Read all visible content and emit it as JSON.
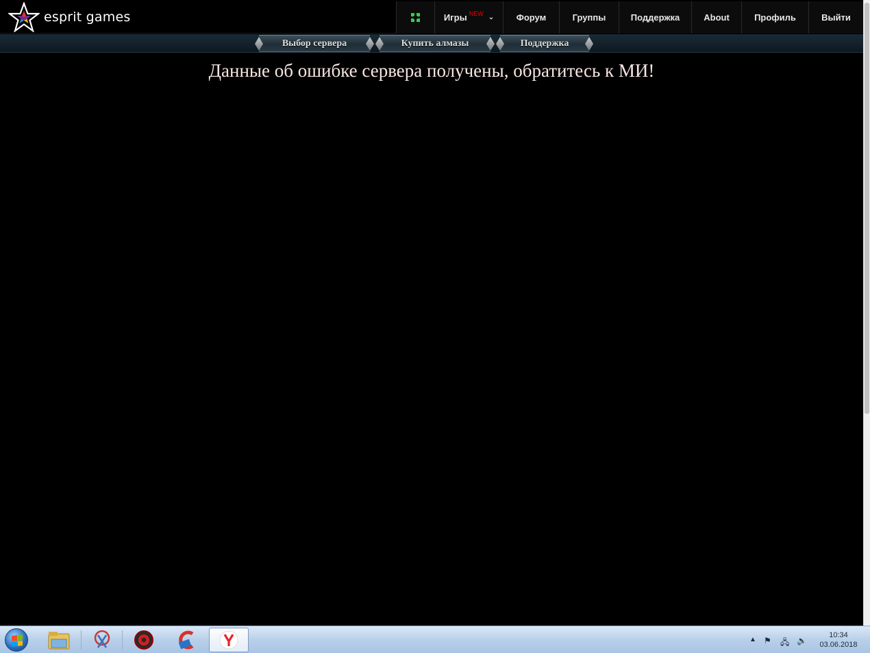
{
  "logo": {
    "text": "esprit games"
  },
  "topnav": {
    "fullscreen_icon": "fullscreen-icon",
    "items": [
      {
        "label": "Игры",
        "badge": "NEW",
        "chevron": "⌄"
      },
      {
        "label": "Форум"
      },
      {
        "label": "Группы"
      },
      {
        "label": "Поддержка"
      },
      {
        "label": "About"
      },
      {
        "label": "Профиль"
      },
      {
        "label": "Выйти"
      }
    ]
  },
  "subnav": {
    "items": [
      {
        "label": "Выбор сервера"
      },
      {
        "label": "Купить алмазы"
      },
      {
        "label": "Поддержка"
      }
    ]
  },
  "content": {
    "error_message": "Данные об ошибке сервера получены, обратитесь к МИ!"
  },
  "taskbar": {
    "apps": [
      "windows-explorer-icon",
      "snipping-tool-icon",
      "security-app-icon",
      "ccleaner-icon",
      "yandex-browser-icon"
    ],
    "clock": {
      "time": "10:34",
      "date": "03.06.2018"
    }
  },
  "colors": {
    "background": "#000000",
    "error_text": "#f6e6e2",
    "badge": "#ee0000",
    "taskbar": "#b9d0ea"
  }
}
